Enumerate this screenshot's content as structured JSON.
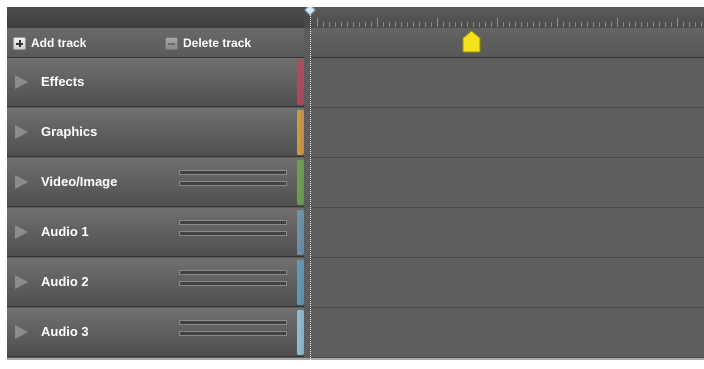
{
  "toolbar": {
    "add_track_label": "Add track",
    "delete_track_label": "Delete track"
  },
  "tracks": [
    {
      "label": "Effects",
      "color": "#b2495c",
      "has_meters": false
    },
    {
      "label": "Graphics",
      "color": "#d49a45",
      "has_meters": false
    },
    {
      "label": "Video/Image",
      "color": "#6fa24f",
      "has_meters": true
    },
    {
      "label": "Audio 1",
      "color": "#6d95b0",
      "has_meters": true
    },
    {
      "label": "Audio 2",
      "color": "#5f9bbf",
      "has_meters": true
    },
    {
      "label": "Audio 3",
      "color": "#8fc0dc",
      "has_meters": true
    }
  ],
  "icons": {
    "add": "plus-icon",
    "delete": "minus-icon",
    "expand": "triangle-right-icon",
    "marker": "playhead-marker-icon"
  },
  "colors": {
    "marker_fill": "#f4e21a",
    "background": "#5b5b5b"
  }
}
